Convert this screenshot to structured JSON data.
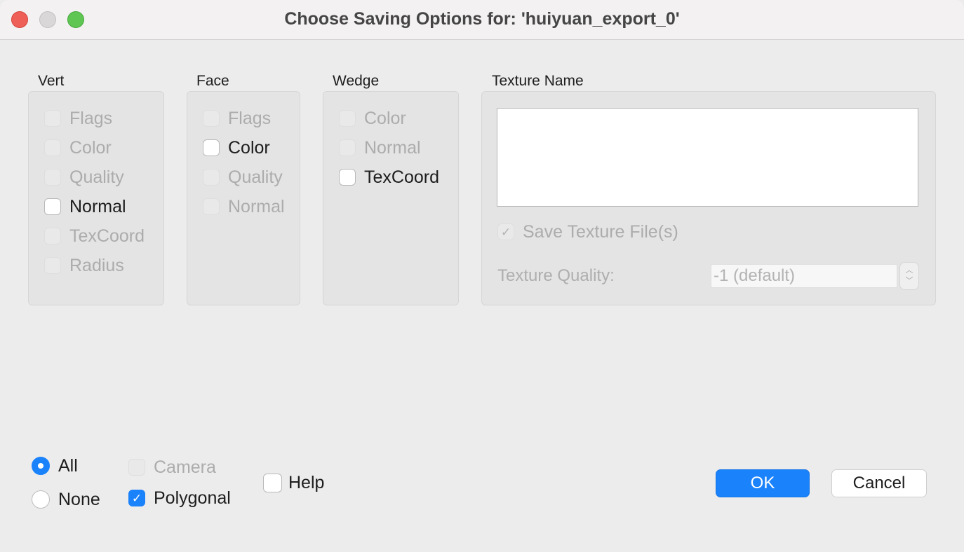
{
  "window": {
    "title": "Choose Saving Options for: 'huiyuan_export_0'"
  },
  "groups": {
    "vert": {
      "label": "Vert",
      "items": [
        {
          "label": "Flags",
          "checked": false,
          "disabled": true
        },
        {
          "label": "Color",
          "checked": false,
          "disabled": true
        },
        {
          "label": "Quality",
          "checked": false,
          "disabled": true
        },
        {
          "label": "Normal",
          "checked": false,
          "disabled": false
        },
        {
          "label": "TexCoord",
          "checked": false,
          "disabled": true
        },
        {
          "label": "Radius",
          "checked": false,
          "disabled": true
        }
      ]
    },
    "face": {
      "label": "Face",
      "items": [
        {
          "label": "Flags",
          "checked": false,
          "disabled": true
        },
        {
          "label": "Color",
          "checked": false,
          "disabled": false
        },
        {
          "label": "Quality",
          "checked": false,
          "disabled": true
        },
        {
          "label": "Normal",
          "checked": false,
          "disabled": true
        }
      ]
    },
    "wedge": {
      "label": "Wedge",
      "items": [
        {
          "label": "Color",
          "checked": false,
          "disabled": true
        },
        {
          "label": "Normal",
          "checked": false,
          "disabled": true
        },
        {
          "label": "TexCoord",
          "checked": false,
          "disabled": false
        }
      ]
    },
    "texture": {
      "label": "Texture Name",
      "name_value": "",
      "save_texture_label": "Save Texture File(s)",
      "save_texture_checked": true,
      "save_texture_disabled": true,
      "quality_label": "Texture Quality:",
      "quality_value": "-1 (default)"
    }
  },
  "bottom": {
    "radio_all": "All",
    "radio_none": "None",
    "radio_selected": "All",
    "camera": {
      "label": "Camera",
      "checked": false,
      "disabled": true
    },
    "polygonal": {
      "label": "Polygonal",
      "checked": true,
      "disabled": false
    },
    "help": {
      "label": "Help",
      "checked": false,
      "disabled": false
    }
  },
  "buttons": {
    "ok": "OK",
    "cancel": "Cancel"
  },
  "icons": {
    "checkmark": "✓",
    "stepper_up": "︿",
    "stepper_down": "﹀"
  },
  "colors": {
    "accent": "#1a82fb"
  }
}
